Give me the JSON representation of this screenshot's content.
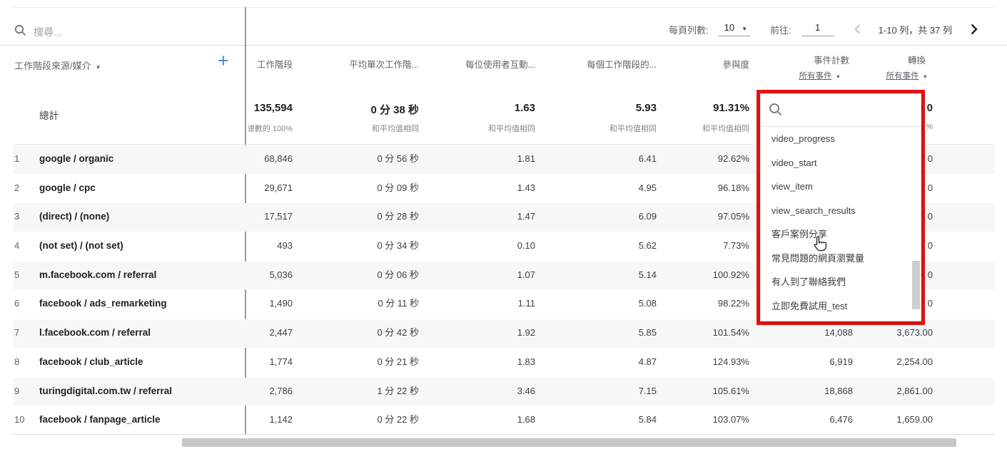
{
  "toolbar": {
    "search_placeholder": "搜尋...",
    "rows_per_page_label": "每頁列數:",
    "rows_per_page_value": "10",
    "goto_label": "前往:",
    "goto_value": "1",
    "range_text": "1-10 列，共 37 列"
  },
  "header": {
    "dimension_label": "工作階段來源/媒介",
    "columns": [
      {
        "label": "工作階段"
      },
      {
        "label": "平均單次工作階..."
      },
      {
        "label": "每位使用者互動..."
      },
      {
        "label": "每個工作階段的..."
      },
      {
        "label": "參與度"
      },
      {
        "label": "事件計數",
        "sub": "所有事件"
      },
      {
        "label": "轉換",
        "sub": "所有事件"
      }
    ]
  },
  "totals": {
    "label": "總計",
    "sessions": "135,594",
    "sessions_sub": "總數的 100%",
    "duration": "0 分 38 秒",
    "duration_sub": "和平均值相同",
    "per_user": "1.63",
    "per_user_sub": "和平均值相同",
    "per_session": "5.93",
    "per_session_sub": "和平均值相同",
    "engagement": "91.31%",
    "engagement_sub": "和平均值相同",
    "conversions_visible_fragment": "0",
    "conversions_sub_visible_fragment": "%"
  },
  "table": {
    "rows": [
      {
        "index": "1",
        "name": "google / organic",
        "sessions": "68,846",
        "duration": "0 分 56 秒",
        "per_user": "1.81",
        "per_session": "6.41",
        "engagement": "92.62%",
        "events": "",
        "conversions": "0"
      },
      {
        "index": "2",
        "name": "google / cpc",
        "sessions": "29,671",
        "duration": "0 分 09 秒",
        "per_user": "1.43",
        "per_session": "4.95",
        "engagement": "96.18%",
        "events": "",
        "conversions": "0"
      },
      {
        "index": "3",
        "name": "(direct) / (none)",
        "sessions": "17,517",
        "duration": "0 分 28 秒",
        "per_user": "1.47",
        "per_session": "6.09",
        "engagement": "97.05%",
        "events": "",
        "conversions": "0"
      },
      {
        "index": "4",
        "name": "(not set) / (not set)",
        "sessions": "493",
        "duration": "0 分 34 秒",
        "per_user": "0.10",
        "per_session": "5.62",
        "engagement": "7.73%",
        "events": "",
        "conversions": "0"
      },
      {
        "index": "5",
        "name": "m.facebook.com / referral",
        "sessions": "5,036",
        "duration": "0 分 06 秒",
        "per_user": "1.07",
        "per_session": "5.14",
        "engagement": "100.92%",
        "events": "",
        "conversions": "0"
      },
      {
        "index": "6",
        "name": "facebook / ads_remarketing",
        "sessions": "1,490",
        "duration": "0 分 11 秒",
        "per_user": "1.11",
        "per_session": "5.08",
        "engagement": "98.22%",
        "events": "",
        "conversions": "0"
      },
      {
        "index": "7",
        "name": "l.facebook.com / referral",
        "sessions": "2,447",
        "duration": "0 分 42 秒",
        "per_user": "1.92",
        "per_session": "5.85",
        "engagement": "101.54%",
        "events": "14,088",
        "conversions": "3,673.00"
      },
      {
        "index": "8",
        "name": "facebook / club_article",
        "sessions": "1,774",
        "duration": "0 分 21 秒",
        "per_user": "1.83",
        "per_session": "4.87",
        "engagement": "124.93%",
        "events": "6,919",
        "conversions": "2,254.00"
      },
      {
        "index": "9",
        "name": "turingdigital.com.tw / referral",
        "sessions": "2,786",
        "duration": "1 分 22 秒",
        "per_user": "3.46",
        "per_session": "7.15",
        "engagement": "105.61%",
        "events": "18,868",
        "conversions": "2,861.00"
      },
      {
        "index": "10",
        "name": "facebook / fanpage_article",
        "sessions": "1,142",
        "duration": "0 分 22 秒",
        "per_user": "1.68",
        "per_session": "5.84",
        "engagement": "103.07%",
        "events": "6,476",
        "conversions": "1,659.00"
      }
    ]
  },
  "dropdown": {
    "items": [
      "video_progress",
      "video_start",
      "view_item",
      "view_search_results",
      "客戶案例分享",
      "常見問題的網頁瀏覽量",
      "有人到了聯絡我們",
      "立即免費試用_test"
    ]
  },
  "colors": {
    "accent_blue": "#4285f4",
    "annotation_red": "#e81313",
    "header_gray": "#5f6368",
    "row_stripe": "#f6f7f7"
  }
}
